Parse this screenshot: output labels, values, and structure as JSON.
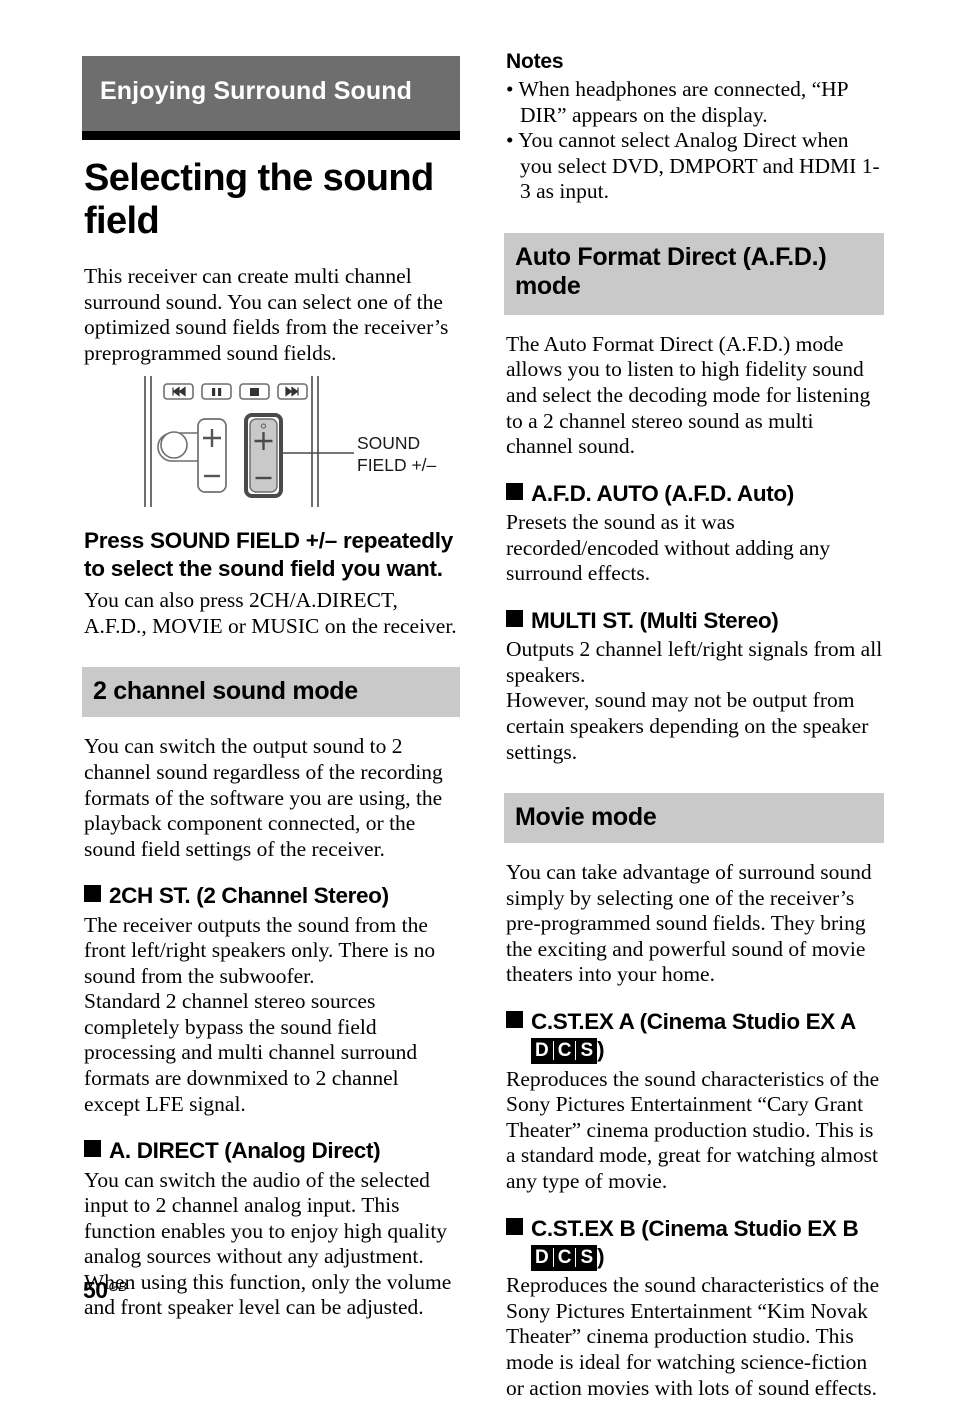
{
  "chapter": {
    "banner_title": "Enjoying Surround Sound"
  },
  "page_title": "Selecting the sound field",
  "intro": {
    "paragraph": "This receiver can create multi channel surround sound. You can select one of the optimized sound fields from the receiver’s preprogrammed sound fields."
  },
  "remote_diagram": {
    "callout_label": "SOUND\nFIELD +/–",
    "buttons": {
      "prev": "prev-track",
      "pause": "pause",
      "stop": "stop",
      "next": "next-track",
      "volume_plus": "+",
      "volume_minus": "–",
      "soundfield_plus": "+",
      "soundfield_minus": "–"
    }
  },
  "instruction": {
    "bold_text": "Press SOUND FIELD +/– repeatedly to select the sound field you want.",
    "follow_up": "You can also press 2CH/A.DIRECT, A.F.D., MOVIE or MUSIC on the receiver."
  },
  "sections": {
    "two_channel": {
      "heading": "2 channel sound mode",
      "intro": "You can switch the output sound to 2 channel sound regardless of the recording formats of the software you are using, the playback component connected, or the sound field settings of the receiver.",
      "items": [
        {
          "title": "2CH ST. (2 Channel Stereo)",
          "paragraphs": [
            "The receiver outputs the sound from the front left/right speakers only. There is no sound from the subwoofer.",
            "Standard 2 channel stereo sources completely bypass the sound field processing and multi channel surround formats are downmixed to 2 channel except LFE signal."
          ]
        },
        {
          "title": "A. DIRECT (Analog Direct)",
          "paragraphs": [
            "You can switch the audio of the selected input to 2 channel analog input. This function enables you to enjoy high quality analog sources without any adjustment.",
            "When using this function, only the volume and front speaker level can be adjusted."
          ]
        }
      ]
    },
    "afd": {
      "heading": "Auto Format Direct (A.F.D.) mode",
      "heading_line1": "Auto Format Direct (A.F.D.)",
      "heading_line2": "mode",
      "intro": "The Auto Format Direct (A.F.D.) mode allows you to listen to high fidelity sound and select the decoding mode for listening to a 2 channel stereo sound as multi channel sound.",
      "items": [
        {
          "title": "A.F.D. AUTO (A.F.D. Auto)",
          "paragraphs": [
            "Presets the sound as it was recorded/encoded without adding any surround effects."
          ]
        },
        {
          "title": "MULTI ST. (Multi Stereo)",
          "paragraphs": [
            "Outputs 2 channel left/right signals from all speakers.",
            "However, sound may not be output from certain speakers depending on the speaker settings."
          ]
        }
      ]
    },
    "movie": {
      "heading": "Movie mode",
      "intro": "You can take advantage of surround sound simply by selecting one of the receiver’s pre-programmed sound fields. They bring the exciting and powerful sound of movie theaters into your home.",
      "items": [
        {
          "title_line1": "C.ST.EX A (Cinema Studio EX A",
          "badge": [
            "D",
            "C",
            "S"
          ],
          "title_close": ")",
          "paragraphs": [
            "Reproduces the sound characteristics of the Sony Pictures Entertainment “Cary Grant Theater” cinema production studio. This is a standard mode, great for watching almost any type of movie."
          ]
        },
        {
          "title_line1": "C.ST.EX B (Cinema Studio EX B",
          "badge": [
            "D",
            "C",
            "S"
          ],
          "title_close": ")",
          "paragraphs": [
            "Reproduces the sound characteristics of the Sony Pictures Entertainment “Kim Novak Theater” cinema production studio. This mode is ideal for watching science-fiction or action movies with lots of sound effects."
          ]
        }
      ]
    }
  },
  "notes": {
    "title": "Notes",
    "items": [
      "• When headphones are connected, “HP DIR” appears on the display.",
      "• You cannot select Analog Direct when you select DVD, DMPORT and HDMI 1-3 as input."
    ]
  },
  "footer": {
    "page_number": "50",
    "region_code": "GB"
  },
  "colors": {
    "banner_gray": "#6e6e6e",
    "section_heading_gray": "#c9c9c9",
    "rule_black": "#000000"
  }
}
